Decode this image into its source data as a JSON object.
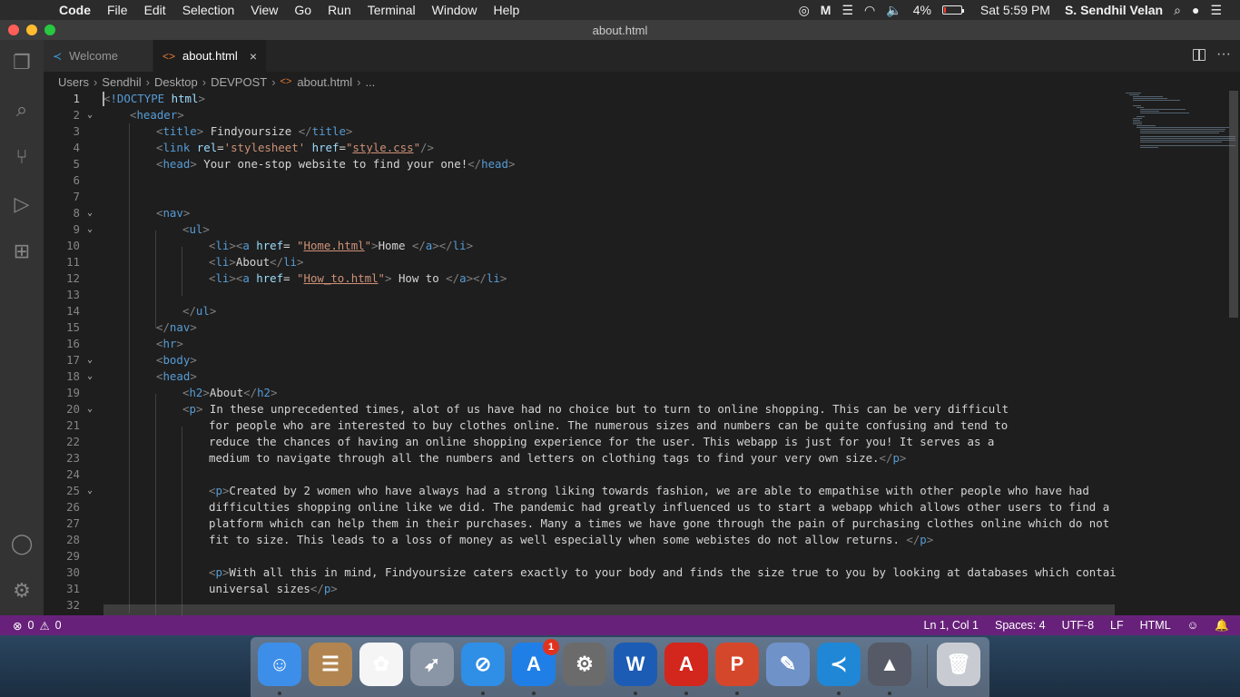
{
  "menubar": {
    "apple": "",
    "app_name": "Code",
    "menus": [
      "File",
      "Edit",
      "Selection",
      "View",
      "Go",
      "Run",
      "Terminal",
      "Window",
      "Help"
    ],
    "battery_percent": "4%",
    "battery_level": 0.04,
    "clock": "Sat 5:59 PM",
    "user": "S. Sendhil Velan"
  },
  "window": {
    "title": "about.html"
  },
  "tabs": [
    {
      "label": "Welcome",
      "active": false
    },
    {
      "label": "about.html",
      "active": true,
      "close": "×"
    }
  ],
  "breadcrumb": [
    "Users",
    "Sendhil",
    "Desktop",
    "DEVPOST",
    "about.html",
    "..."
  ],
  "editor": {
    "current_line": 1,
    "lines": [
      {
        "n": "1",
        "f": "",
        "i": 0,
        "h": "<span class='br'>&lt;</span><span class='tag'>!DOCTYPE</span> <span class='attr'>html</span><span class='br'>&gt;</span>"
      },
      {
        "n": "2",
        "f": "v",
        "i": 1,
        "h": "<span class='br'>&lt;</span><span class='tag'>header</span><span class='br'>&gt;</span>"
      },
      {
        "n": "3",
        "f": "",
        "i": 2,
        "h": "<span class='br'>&lt;</span><span class='tag'>title</span><span class='br'>&gt;</span> Findyoursize <span class='br'>&lt;/</span><span class='tag'>title</span><span class='br'>&gt;</span>"
      },
      {
        "n": "4",
        "f": "",
        "i": 2,
        "h": "<span class='br'>&lt;</span><span class='tag'>link</span> <span class='attr'>rel</span>=<span class='strp'>'stylesheet'</span> <span class='attr'>href</span>=<span class='strp'>\"</span><span class='str'>style.css</span><span class='strp'>\"</span><span class='br'>/&gt;</span>"
      },
      {
        "n": "5",
        "f": "",
        "i": 2,
        "h": "<span class='br'>&lt;</span><span class='tag'>head</span><span class='br'>&gt;</span> Your one-stop website to find your one!<span class='br'>&lt;/</span><span class='tag'>head</span><span class='br'>&gt;</span>"
      },
      {
        "n": "6",
        "f": "",
        "i": 0,
        "h": ""
      },
      {
        "n": "7",
        "f": "",
        "i": 0,
        "h": ""
      },
      {
        "n": "8",
        "f": "v",
        "i": 2,
        "h": "<span class='br'>&lt;</span><span class='tag'>nav</span><span class='br'>&gt;</span>"
      },
      {
        "n": "9",
        "f": "v",
        "i": 3,
        "h": "<span class='br'>&lt;</span><span class='tag'>ul</span><span class='br'>&gt;</span>"
      },
      {
        "n": "10",
        "f": "",
        "i": 4,
        "h": "<span class='br'>&lt;</span><span class='tag'>li</span><span class='br'>&gt;&lt;</span><span class='tag'>a</span> <span class='attr'>href</span>= <span class='strp'>\"</span><span class='str'>Home.html</span><span class='strp'>\"</span><span class='br'>&gt;</span>Home <span class='br'>&lt;/</span><span class='tag'>a</span><span class='br'>&gt;&lt;/</span><span class='tag'>li</span><span class='br'>&gt;</span>"
      },
      {
        "n": "11",
        "f": "",
        "i": 4,
        "h": "<span class='br'>&lt;</span><span class='tag'>li</span><span class='br'>&gt;</span>About<span class='br'>&lt;/</span><span class='tag'>li</span><span class='br'>&gt;</span>"
      },
      {
        "n": "12",
        "f": "",
        "i": 4,
        "h": "<span class='br'>&lt;</span><span class='tag'>li</span><span class='br'>&gt;&lt;</span><span class='tag'>a</span> <span class='attr'>href</span>= <span class='strp'>\"</span><span class='str'>How_to.html</span><span class='strp'>\"</span><span class='br'>&gt;</span> How to <span class='br'>&lt;/</span><span class='tag'>a</span><span class='br'>&gt;&lt;/</span><span class='tag'>li</span><span class='br'>&gt;</span>"
      },
      {
        "n": "13",
        "f": "",
        "i": 0,
        "h": ""
      },
      {
        "n": "14",
        "f": "",
        "i": 3,
        "h": "<span class='br'>&lt;/</span><span class='tag'>ul</span><span class='br'>&gt;</span>"
      },
      {
        "n": "15",
        "f": "",
        "i": 2,
        "h": "<span class='br'>&lt;/</span><span class='tag'>nav</span><span class='br'>&gt;</span>"
      },
      {
        "n": "16",
        "f": "",
        "i": 2,
        "h": "<span class='br'>&lt;</span><span class='tag'>hr</span><span class='br'>&gt;</span>"
      },
      {
        "n": "17",
        "f": "v",
        "i": 2,
        "h": "<span class='br'>&lt;</span><span class='tag'>body</span><span class='br'>&gt;</span>"
      },
      {
        "n": "18",
        "f": "v",
        "i": 2,
        "h": "<span class='br'>&lt;</span><span class='tag'>head</span><span class='br'>&gt;</span>"
      },
      {
        "n": "19",
        "f": "",
        "i": 3,
        "h": "<span class='br'>&lt;</span><span class='tag'>h2</span><span class='br'>&gt;</span>About<span class='br'>&lt;/</span><span class='tag'>h2</span><span class='br'>&gt;</span>"
      },
      {
        "n": "20",
        "f": "v",
        "i": 3,
        "h": "<span class='br'>&lt;</span><span class='tag'>p</span><span class='br'>&gt;</span> In these unprecedented times, alot of us have had no choice but to turn to online shopping. This can be very difficult"
      },
      {
        "n": "21",
        "f": "",
        "i": 4,
        "h": "for people who are interested to buy clothes online. The numerous sizes and numbers can be quite confusing and tend to"
      },
      {
        "n": "22",
        "f": "",
        "i": 4,
        "h": "reduce the chances of having an online shopping experience for the user. This webapp is just for you! It serves as a"
      },
      {
        "n": "23",
        "f": "",
        "i": 4,
        "h": "medium to navigate through all the numbers and letters on clothing tags to find your very own size.<span class='br'>&lt;/</span><span class='tag'>p</span><span class='br'>&gt;</span>"
      },
      {
        "n": "24",
        "f": "",
        "i": 0,
        "h": ""
      },
      {
        "n": "25",
        "f": "v",
        "i": 4,
        "h": "<span class='br'>&lt;</span><span class='tag'>p</span><span class='br'>&gt;</span>Created by 2 women who have always had a strong liking towards fashion, we are able to empathise with other people who have had"
      },
      {
        "n": "26",
        "f": "",
        "i": 4,
        "h": "difficulties shopping online like we did. The pandemic had greatly influenced us to start a webapp which allows other users to find a"
      },
      {
        "n": "27",
        "f": "",
        "i": 4,
        "h": "platform which can help them in their purchases. Many a times we have gone through the pain of purchasing clothes online which do not"
      },
      {
        "n": "28",
        "f": "",
        "i": 4,
        "h": "fit to size. This leads to a loss of money as well especially when some webistes do not allow returns. <span class='br'>&lt;/</span><span class='tag'>p</span><span class='br'>&gt;</span>"
      },
      {
        "n": "29",
        "f": "",
        "i": 0,
        "h": ""
      },
      {
        "n": "30",
        "f": "",
        "i": 4,
        "h": "<span class='br'>&lt;</span><span class='tag'>p</span><span class='br'>&gt;</span>With all this in mind, Findyoursize caters exactly to your body and finds the size true to you by looking at databases which contain"
      },
      {
        "n": "31",
        "f": "",
        "i": 4,
        "h": "universal sizes<span class='br'>&lt;/</span><span class='tag'>p</span><span class='br'>&gt;</span>"
      },
      {
        "n": "32",
        "f": "",
        "i": 0,
        "h": ""
      }
    ]
  },
  "statusbar": {
    "errors": "0",
    "warnings": "0",
    "position": "Ln 1, Col 1",
    "spaces": "Spaces: 4",
    "encoding": "UTF-8",
    "eol": "LF",
    "language": "HTML"
  },
  "dock": {
    "apps": [
      {
        "name": "finder",
        "color": "#3d8ee8",
        "glyph": "☺",
        "running": true
      },
      {
        "name": "contacts",
        "color": "#b28550",
        "glyph": "☰",
        "running": false
      },
      {
        "name": "photos",
        "color": "#f5f5f5",
        "glyph": "✿",
        "running": false
      },
      {
        "name": "launchpad",
        "color": "#8a95a5",
        "glyph": "➶",
        "running": false
      },
      {
        "name": "safari",
        "color": "#2f8ee6",
        "glyph": "⊘",
        "running": true
      },
      {
        "name": "app-store",
        "color": "#1f7fe6",
        "glyph": "A",
        "running": true,
        "badge": "1"
      },
      {
        "name": "system-preferences",
        "color": "#6b6b6b",
        "glyph": "⚙",
        "running": false
      },
      {
        "name": "word",
        "color": "#1c5cb5",
        "glyph": "W",
        "running": true
      },
      {
        "name": "acrobat",
        "color": "#d3261d",
        "glyph": "A",
        "running": true
      },
      {
        "name": "powerpoint",
        "color": "#d5472b",
        "glyph": "P",
        "running": true
      },
      {
        "name": "preview",
        "color": "#6f93c9",
        "glyph": "✎",
        "running": false
      },
      {
        "name": "vscode",
        "color": "#1f87d6",
        "glyph": "≺",
        "running": true
      },
      {
        "name": "rocket",
        "color": "#555a66",
        "glyph": "▲",
        "running": true
      },
      {
        "name": "trash",
        "color": "#c8ccd2",
        "glyph": "🗑",
        "running": false
      }
    ]
  }
}
